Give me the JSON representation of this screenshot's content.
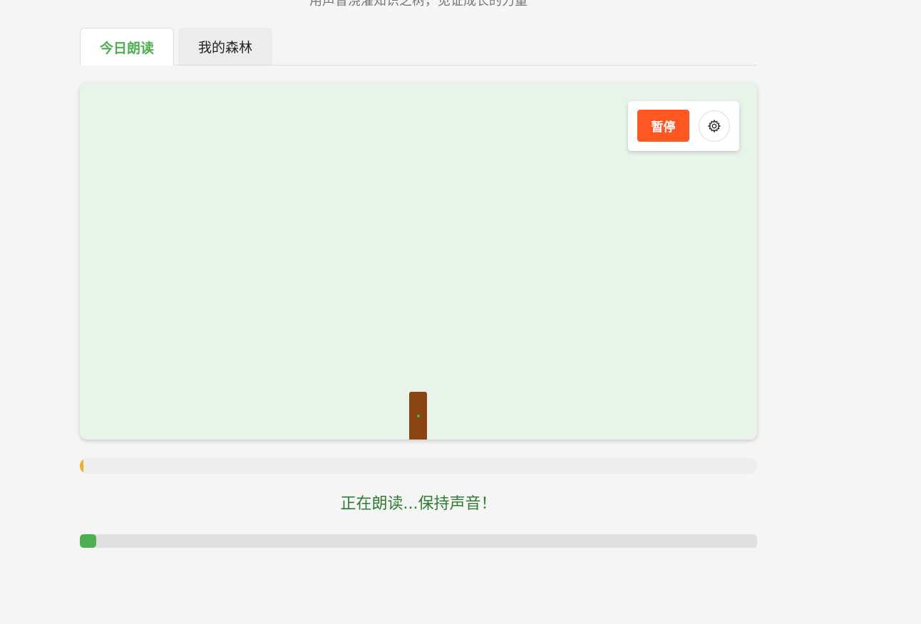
{
  "header": {
    "subtitle": "用声音浇灌知识之树，见证成长的力量"
  },
  "tabs": [
    {
      "label": "今日朗读",
      "active": true
    },
    {
      "label": "我的森林",
      "active": false
    }
  ],
  "controls": {
    "pause_label": "暂停",
    "settings_icon": "gear-icon"
  },
  "volume_meter": {
    "level_percent": 0.5
  },
  "status": {
    "text": "正在朗读...保持声音！"
  },
  "reading_progress": {
    "percent": 2.4
  },
  "colors": {
    "accent_green": "#4caf50",
    "pause_orange": "#ff5722",
    "trunk_brown": "#8b4513",
    "status_green": "#2e7d32",
    "volume_yellow": "#f2b01e",
    "scene_background": "#e8f4ea"
  }
}
